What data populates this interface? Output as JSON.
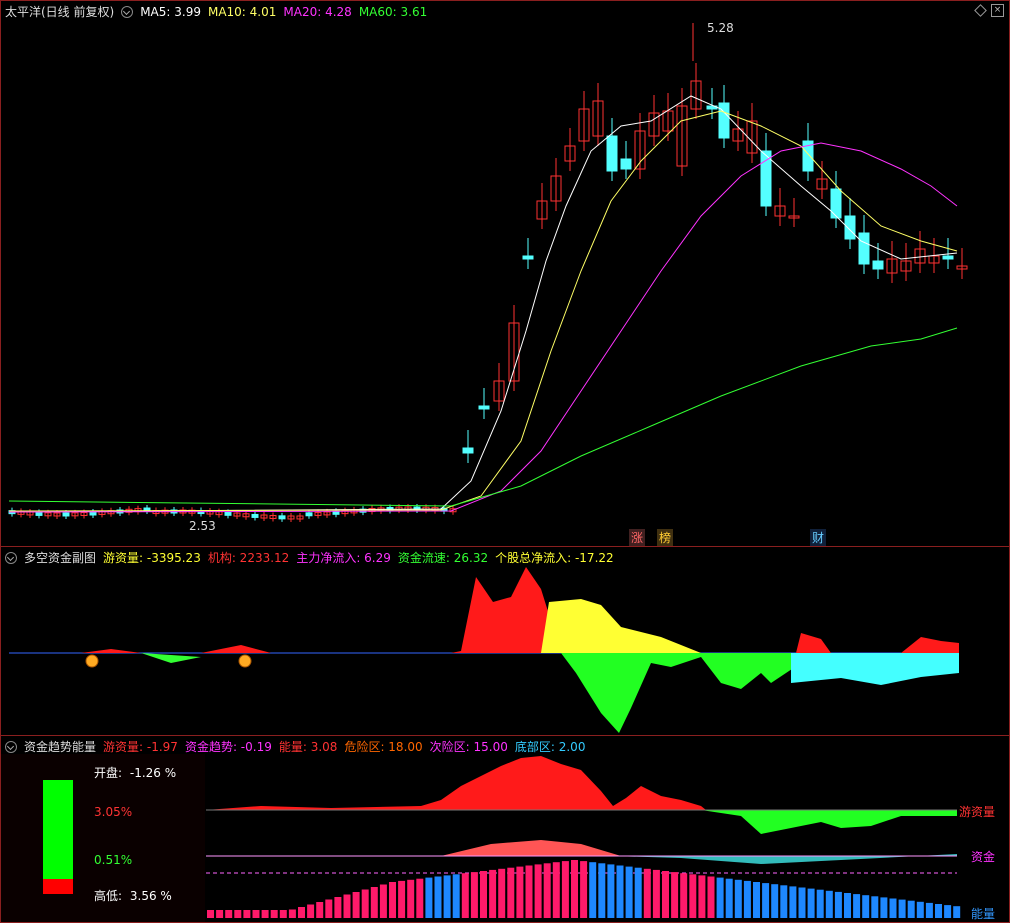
{
  "main_chart": {
    "title": "太平洋(日线 前复权)",
    "ma": [
      {
        "label": "MA5: 3.99",
        "color": "#ffffff"
      },
      {
        "label": "MA10: 4.01",
        "color": "#ffff66"
      },
      {
        "label": "MA20: 4.28",
        "color": "#ff33ff"
      },
      {
        "label": "MA60: 3.61",
        "color": "#33ff33"
      }
    ],
    "high_label": "5.28",
    "low_label": "2.53",
    "markers": {
      "zhang": "涨",
      "bang": "榜",
      "cai": "财"
    },
    "up_color": "#ff3232",
    "down_color": "#54ffff"
  },
  "panel2": {
    "title": "多空资金副图",
    "fields": [
      {
        "label": "游资量: -3395.23",
        "color": "#ffff33"
      },
      {
        "label": "机构: 2233.12",
        "color": "#ff3333"
      },
      {
        "label": "主力净流入: 6.29",
        "color": "#ff33ff"
      },
      {
        "label": "资金流速: 26.32",
        "color": "#33ff33"
      },
      {
        "label": "个股总净流入: -17.22",
        "color": "#ffff33"
      }
    ]
  },
  "panel3": {
    "title": "资金趋势能量",
    "fields": [
      {
        "label": "游资量: -1.97",
        "color": "#ff3333"
      },
      {
        "label": "资金趋势: -0.19",
        "color": "#ff33ff"
      },
      {
        "label": "能量: 3.08",
        "color": "#ff3333"
      },
      {
        "label": "危险区: 18.00",
        "color": "#ff6600"
      },
      {
        "label": "次险区: 15.00",
        "color": "#ff33ff"
      },
      {
        "label": "底部区: 2.00",
        "color": "#33ccff"
      }
    ],
    "side": {
      "open_label": "开盘:",
      "open_val": "-1.26 %",
      "upper_pct": "3.05%",
      "lower_pct": "0.51%",
      "hl_label": "高低:",
      "hl_val": "3.56 %"
    },
    "right_labels": {
      "youzi": "游资量",
      "zijin": "资金",
      "nengliang": "能量"
    }
  }
}
